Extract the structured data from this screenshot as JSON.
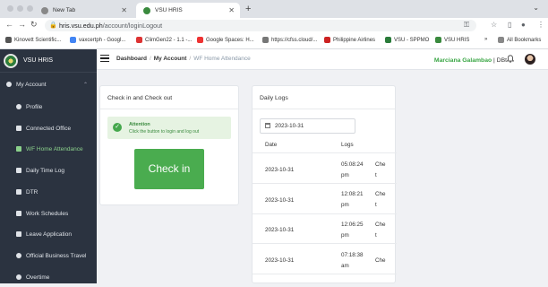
{
  "browser": {
    "tabs": [
      {
        "title": "New Tab",
        "active": false
      },
      {
        "title": "VSU HRIS",
        "active": true
      }
    ],
    "url_host": "hris.vsu.edu.ph",
    "url_path": "/account/loginLogout",
    "bookmarks": [
      "Kinovett Scientific...",
      "vaxcertph - Googl...",
      "ClimGen22 - 1.1 -...",
      "Google Spaces: H...",
      "https://cfss.cloud/...",
      "Philippine Airlines",
      "VSU - SPPMO",
      "VSU HRIS",
      "»",
      "All Bookmarks"
    ]
  },
  "sidebar": {
    "brand": "VSU HRIS",
    "section": "My Account",
    "items": [
      {
        "label": "Profile",
        "active": false
      },
      {
        "label": "Connected Office",
        "active": false
      },
      {
        "label": "WF Home Attendance",
        "active": true
      },
      {
        "label": "Daily Time Log",
        "active": false
      },
      {
        "label": "DTR",
        "active": false
      },
      {
        "label": "Work Schedules",
        "active": false
      },
      {
        "label": "Leave Application",
        "active": false
      },
      {
        "label": "Official Business Travel",
        "active": false
      },
      {
        "label": "Overtime",
        "active": false
      }
    ]
  },
  "header": {
    "breadcrumb": [
      "Dashboard",
      "My Account",
      "WF Home Attendance"
    ],
    "user_name": "Marciana Galambao",
    "user_suffix": "| DBt"
  },
  "checkin_card": {
    "title": "Check in and Check out",
    "alert_title": "Attention",
    "alert_text": "Click the button to login and log out",
    "button_label": "Check in"
  },
  "logs_card": {
    "title": "Daily Logs",
    "date_value": "2023-10-31",
    "columns": [
      "Date",
      "Logs"
    ],
    "rows": [
      {
        "date": "2023-10-31",
        "time": "05:08:24",
        "ampm": "pm",
        "extra": "Che",
        "extra2": "t"
      },
      {
        "date": "2023-10-31",
        "time": "12:08:21",
        "ampm": "pm",
        "extra": "Che",
        "extra2": "t"
      },
      {
        "date": "2023-10-31",
        "time": "12:06:25",
        "ampm": "pm",
        "extra": "Che",
        "extra2": "t"
      },
      {
        "date": "2023-10-31",
        "time": "07:18:38",
        "ampm": "am",
        "extra": "Che",
        "extra2": ""
      }
    ]
  },
  "colors": {
    "accent_green": "#4aac4f",
    "sidebar_bg": "#2b3340"
  }
}
